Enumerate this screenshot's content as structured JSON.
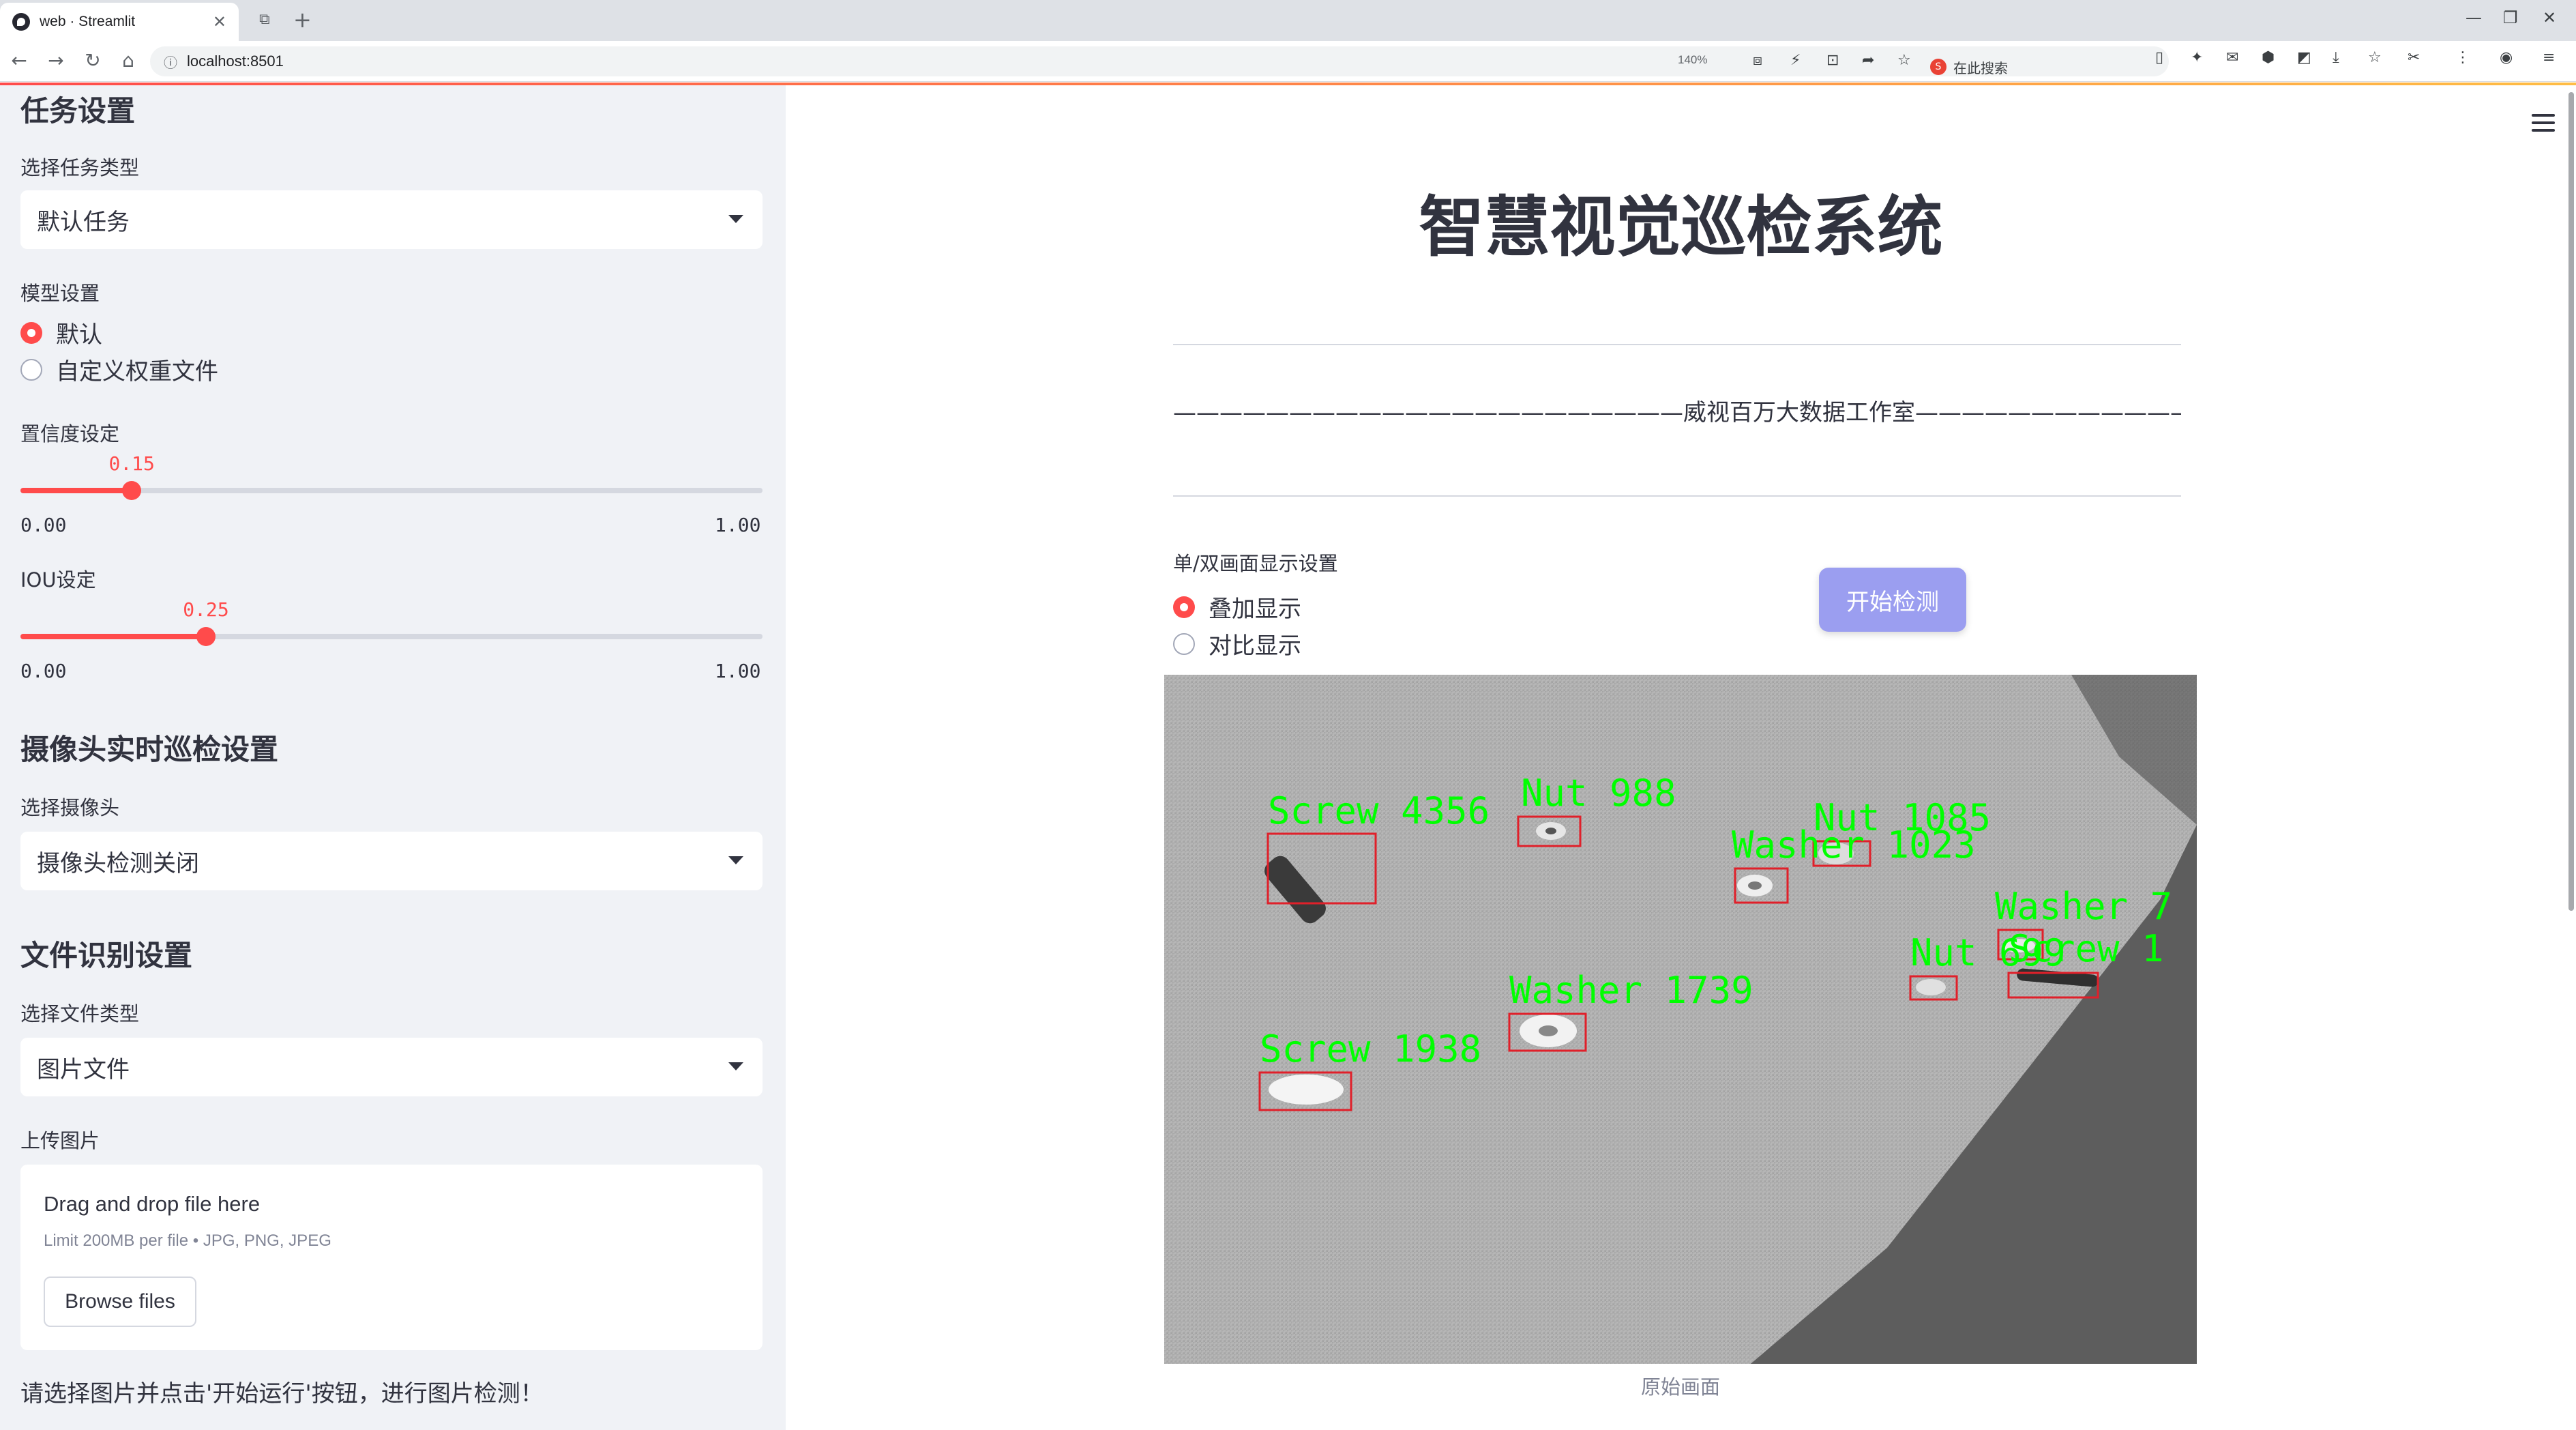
{
  "browser": {
    "tab_title": "web · Streamlit",
    "url": "localhost:8501",
    "zoom": "140%",
    "search_placeholder": "在此搜索"
  },
  "sidebar": {
    "task_section": {
      "heading": "任务设置",
      "select_label": "选择任务类型",
      "select_value": "默认任务"
    },
    "model_section": {
      "label": "模型设置",
      "options": [
        {
          "label": "默认",
          "selected": true
        },
        {
          "label": "自定义权重文件",
          "selected": false
        }
      ]
    },
    "confidence": {
      "label": "置信度设定",
      "value": "0.15",
      "min": "0.00",
      "max": "1.00",
      "fraction": 0.15
    },
    "iou": {
      "label": "IOU设定",
      "value": "0.25",
      "min": "0.00",
      "max": "1.00",
      "fraction": 0.25
    },
    "camera_section": {
      "heading": "摄像头实时巡检设置",
      "select_label": "选择摄像头",
      "select_value": "摄像头检测关闭"
    },
    "file_section": {
      "heading": "文件识别设置",
      "select_label": "选择文件类型",
      "select_value": "图片文件"
    },
    "upload": {
      "label": "上传图片",
      "drag_text": "Drag and drop file here",
      "limit_text": "Limit 200MB per file • JPG, PNG, JPEG",
      "browse_label": "Browse files"
    },
    "note": "请选择图片并点击'开始运行'按钮，进行图片检测！"
  },
  "main": {
    "title": "智慧视觉巡检系统",
    "studio_line": "——————————————————————威视百万大数据工作室———————————————————————",
    "display_label": "单/双画面显示设置",
    "display_options": [
      {
        "label": "叠加显示",
        "selected": true
      },
      {
        "label": "对比显示",
        "selected": false
      }
    ],
    "start_button": "开始检测",
    "image_caption": "原始画面",
    "detections": [
      {
        "label": "Screw 4356",
        "color": "#00ff00"
      },
      {
        "label": "Nut 988",
        "color": "#00ff00"
      },
      {
        "label": "Nut 1085",
        "color": "#00ff00"
      },
      {
        "label": "Washer 1023",
        "color": "#00ff00"
      },
      {
        "label": "Washer 7",
        "color": "#00ff00"
      },
      {
        "label": "Nut 699",
        "color": "#00ff00"
      },
      {
        "label": "Screw 1",
        "color": "#00ff00"
      },
      {
        "label": "Washer 1739",
        "color": "#00ff00"
      },
      {
        "label": "Screw 1938",
        "color": "#00ff00"
      }
    ]
  },
  "colors": {
    "accent": "#ff4b4b",
    "button": "#9b9ef0",
    "sidebar_bg": "#f0f2f6",
    "box": "#e0202a",
    "label": "#00ff00"
  }
}
